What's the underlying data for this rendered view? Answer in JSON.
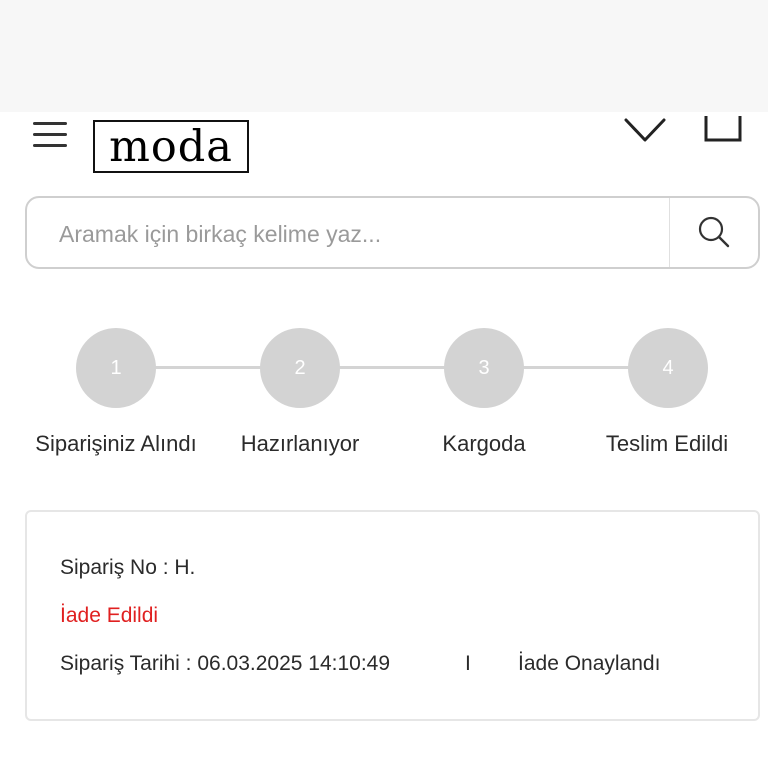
{
  "header": {
    "logo_text": "moda",
    "icons": {
      "menu": "hamburger-menu-icon",
      "chevron": "chevron-down-icon",
      "bag": "shopping-bag-icon"
    }
  },
  "search": {
    "placeholder": "Aramak için birkaç kelime yaz...",
    "value": "",
    "icon": "search-icon"
  },
  "stepper": {
    "steps": [
      {
        "number": "1",
        "label": "Siparişiniz Alındı"
      },
      {
        "number": "2",
        "label": "Hazırlanıyor"
      },
      {
        "number": "3",
        "label": "Kargoda"
      },
      {
        "number": "4",
        "label": "Teslim Edildi"
      }
    ]
  },
  "order": {
    "order_no_label": "Sipariş No : H.",
    "status": "İade Edildi",
    "date_text": "Sipariş Tarihi : 06.03.2025 14:10:49",
    "separator": "I",
    "return_status": "İade Onaylandı",
    "colors": {
      "status": "#e02020"
    }
  },
  "colors": {
    "step_circle": "#d3d3d3",
    "step_line": "#d4d4d4",
    "text": "#2b2b2b",
    "border": "#cfcfcf"
  }
}
